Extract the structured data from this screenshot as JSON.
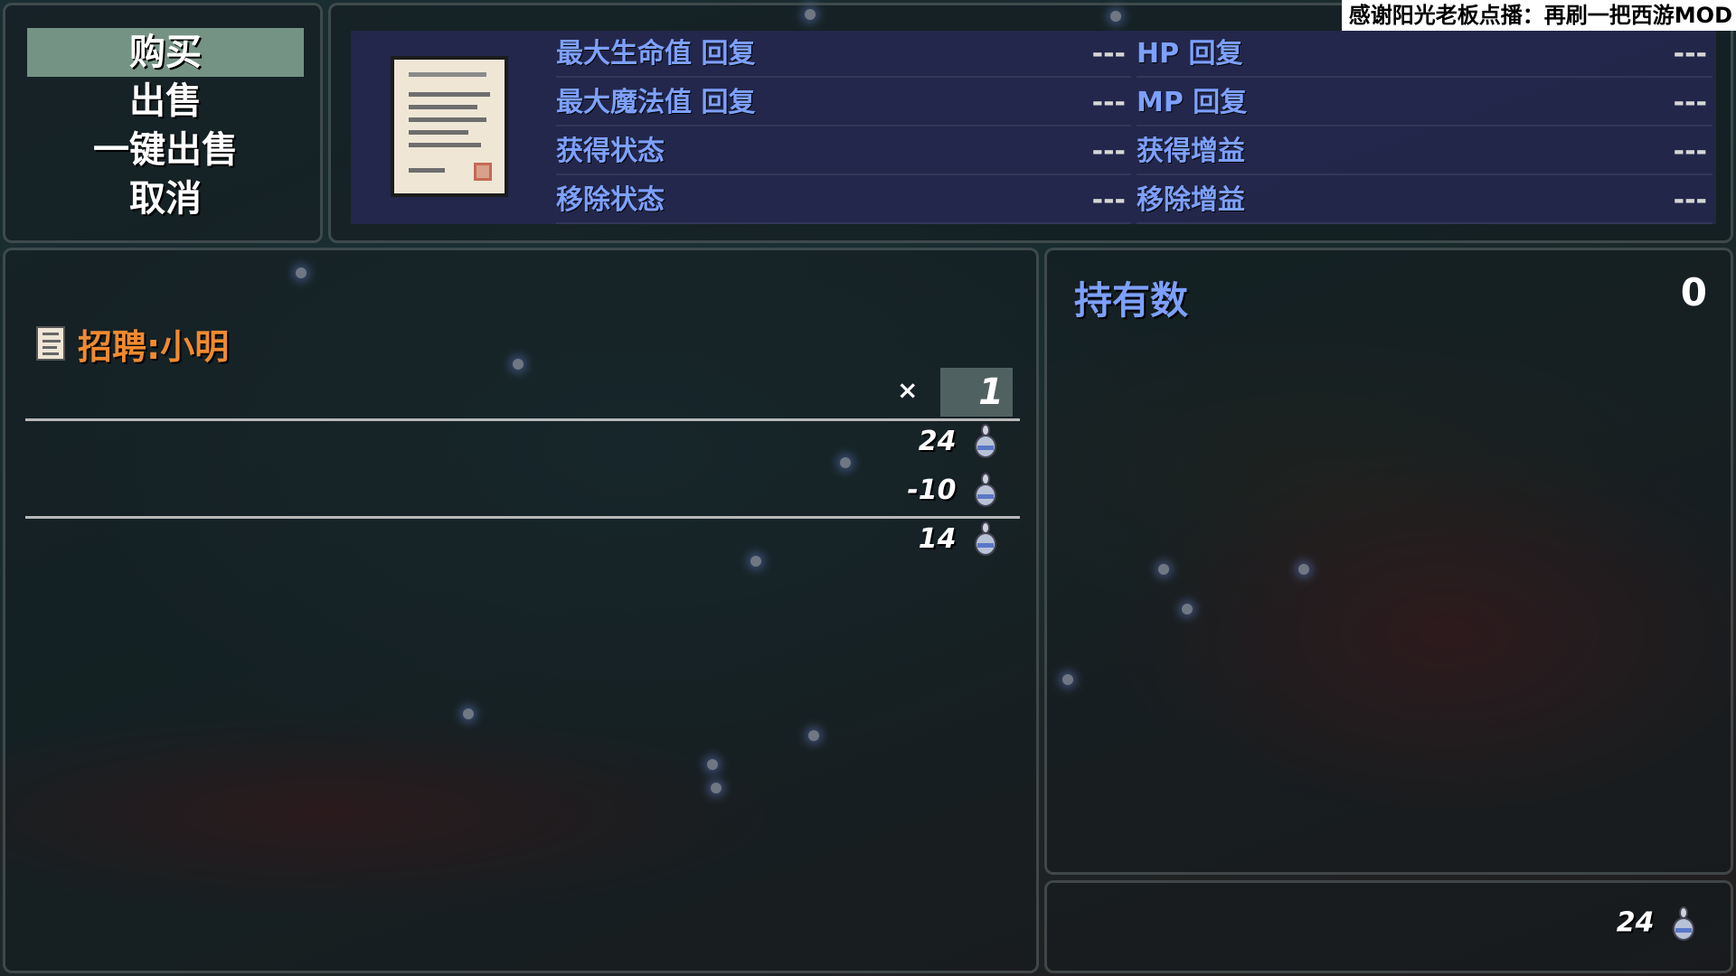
{
  "stream_banner": "感谢阳光老板点播：再刷一把西游MOD",
  "command_menu": {
    "items": [
      {
        "label": "购买",
        "selected": true
      },
      {
        "label": "出售",
        "selected": false
      },
      {
        "label": "一键出售",
        "selected": false
      },
      {
        "label": "取消",
        "selected": false
      }
    ]
  },
  "item_params": {
    "left": [
      {
        "label": "最大生命值 回复",
        "value": "---"
      },
      {
        "label": "最大魔法值 回复",
        "value": "---"
      },
      {
        "label": "获得状态",
        "value": "---"
      },
      {
        "label": "移除状态",
        "value": "---"
      }
    ],
    "right": [
      {
        "label": "HP 回复",
        "value": "---"
      },
      {
        "label": "MP 回复",
        "value": "---"
      },
      {
        "label": "获得增益",
        "value": "---"
      },
      {
        "label": "移除增益",
        "value": "---"
      }
    ]
  },
  "trade": {
    "item_name": "招聘:小明",
    "item_icon": "scroll-icon",
    "times_symbol": "×",
    "quantity": "1",
    "unit_price": "24",
    "change": "-10",
    "total": "14",
    "currency_icon": "gourd-icon"
  },
  "stock": {
    "label": "持有数",
    "value": "0"
  },
  "gold": {
    "amount": "24"
  },
  "colors": {
    "selected_bg": "#96b9a5",
    "param_label": "#7da0ff",
    "item_name": "#f08a30",
    "status_bg": "#282a5a"
  }
}
